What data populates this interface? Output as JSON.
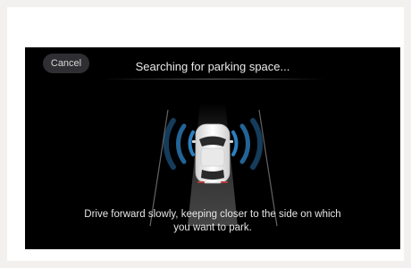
{
  "header": {
    "cancel_label": "Cancel",
    "title": "Searching for parking space..."
  },
  "scene": {
    "car_icon": "car-top-view-icon",
    "sensor_icon": "sensor-waves-icon",
    "accent_color": "#2f86c9",
    "car_color": "#f2f2f2"
  },
  "instruction": {
    "line1": "Drive forward slowly, keeping closer to the side on which",
    "line2": "you want to park."
  }
}
